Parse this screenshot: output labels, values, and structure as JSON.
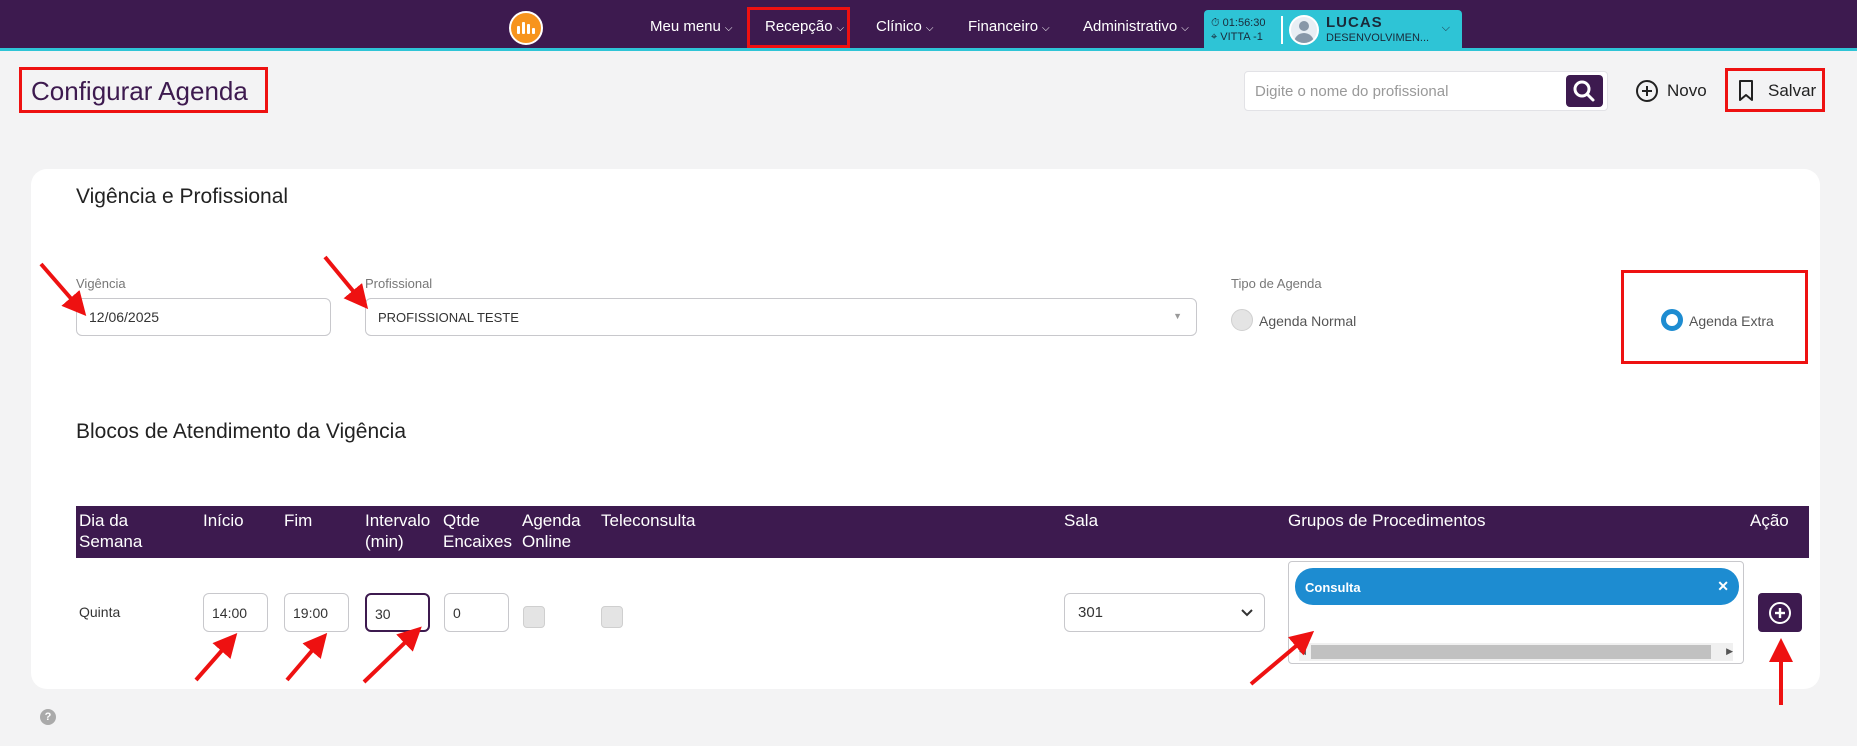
{
  "nav": {
    "items": [
      {
        "label": "Meu menu"
      },
      {
        "label": "Recepção"
      },
      {
        "label": "Clínico"
      },
      {
        "label": "Financeiro"
      },
      {
        "label": "Administrativo"
      }
    ],
    "time": "01:56:30",
    "unit": "VITTA -1",
    "user_name": "LUCAS",
    "user_role": "DESENVOLVIMEN..."
  },
  "header": {
    "title": "Configurar Agenda",
    "search_placeholder": "Digite o nome do profissional",
    "novo_label": "Novo",
    "salvar_label": "Salvar"
  },
  "vigencia_section": {
    "title": "Vigência e Profissional",
    "vigencia_label": "Vigência",
    "vigencia_value": "12/06/2025",
    "profissional_label": "Profissional",
    "profissional_value": "PROFISSIONAL TESTE",
    "tipo_label": "Tipo de Agenda",
    "tipo_options": [
      {
        "label": "Agenda Normal",
        "selected": false
      },
      {
        "label": "Agenda Extra",
        "selected": true
      }
    ]
  },
  "blocos_section": {
    "title": "Blocos de Atendimento da Vigência",
    "columns": [
      {
        "line1": "Dia da",
        "line2": "Semana"
      },
      {
        "line1": "Início",
        "line2": ""
      },
      {
        "line1": "Fim",
        "line2": ""
      },
      {
        "line1": "Intervalo",
        "line2": "(min)"
      },
      {
        "line1": "Qtde",
        "line2": "Encaixes"
      },
      {
        "line1": "Agenda",
        "line2": "Online"
      },
      {
        "line1": "Teleconsulta",
        "line2": ""
      },
      {
        "line1": "Sala",
        "line2": ""
      },
      {
        "line1": "Grupos de Procedimentos",
        "line2": ""
      },
      {
        "line1": "Ação",
        "line2": ""
      }
    ],
    "rows": [
      {
        "dia": "Quinta",
        "inicio": "14:00",
        "fim": "19:00",
        "intervalo": "30",
        "encaixes": "0",
        "agenda_online": false,
        "teleconsulta": false,
        "sala": "301",
        "procedimentos": [
          "Consulta"
        ]
      }
    ]
  },
  "colors": {
    "primary": "#3d1a4f",
    "accent": "#2ec4d6",
    "tag_blue": "#1d8cd1",
    "annotation_red": "#e11111",
    "logo_orange": "#f7941d"
  }
}
